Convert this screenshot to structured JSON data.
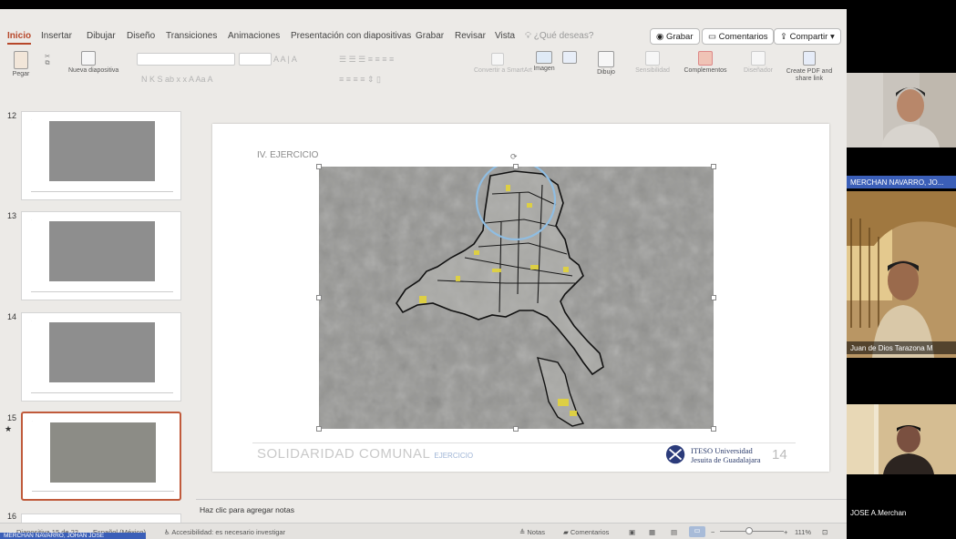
{
  "ribbon": {
    "tabs": [
      "Inicio",
      "Insertar",
      "Dibujar",
      "Diseño",
      "Transiciones",
      "Animaciones",
      "Presentación con diapositivas",
      "Grabar",
      "Revisar",
      "Vista"
    ],
    "search_label": "¿Qué deseas?",
    "record_button": "Grabar",
    "comments_button": "Comentarios",
    "share_button": "Compartir"
  },
  "toolbar": {
    "paste": "Pegar",
    "new_slide": "Nueva diapositiva",
    "convert_smartart": "Convertir a SmartArt",
    "image": "Imagen",
    "drawing": "Dibujo",
    "sensitivity": "Sensibilidad",
    "addins": "Complementos",
    "designer": "Diseñador",
    "create_pdf": "Create PDF and share link"
  },
  "thumbnails": {
    "numbers": [
      "12",
      "13",
      "14",
      "15",
      "16"
    ],
    "star": "★",
    "selected": "15"
  },
  "slide": {
    "title": "IV. EJERCICIO",
    "footer_title": "SOLIDARIDAD COMUNAL",
    "footer_tag": "EJERCICIO",
    "logo_line1": "ITESO Universidad",
    "logo_line2": "Jesuita de Guadalajara",
    "page_number": "14"
  },
  "notes": {
    "placeholder": "Haz clic para agregar notas"
  },
  "status": {
    "slide_info": "Diapositiva 15 de 22",
    "language": "Español (México)",
    "accessibility": "Accesibilidad: es necesario investigar",
    "notes_button": "Notas",
    "comments_button": "Comentarios",
    "zoom": "111%"
  },
  "participants": [
    {
      "name": "MERCHAN NAVARRO, JO..."
    },
    {
      "name": "Juan de Dios Tarazona M"
    },
    {
      "name": "JOSE A.Merchan"
    }
  ],
  "active_speaker": "MERCHAN NAVARRO, JOHAN JOSE",
  "colors": {
    "accent": "#b7472a",
    "speaker_bar": "#3b5fb8",
    "highlight_circle": "#7fb2dc",
    "map_highlight": "#e3d43a"
  }
}
